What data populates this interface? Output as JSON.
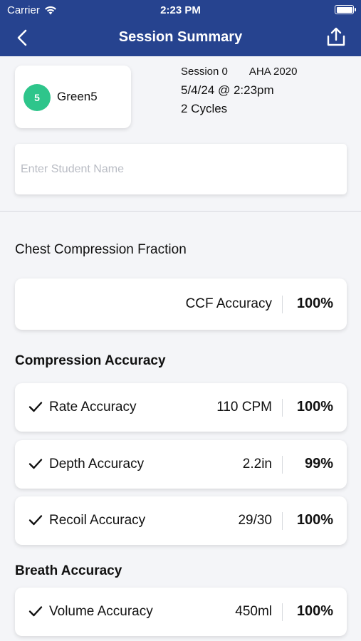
{
  "status_bar": {
    "carrier": "Carrier",
    "time": "2:23 PM"
  },
  "nav": {
    "title": "Session Summary",
    "back_icon": "chevron-left-icon",
    "share_icon": "share-upload-icon"
  },
  "device": {
    "badge": "5",
    "name": "Green5",
    "badge_color": "#2ec58b"
  },
  "session": {
    "label": "Session 0",
    "protocol": "AHA 2020",
    "datetime": "5/4/24 @ 2:23pm",
    "cycles": "2 Cycles"
  },
  "student": {
    "placeholder": "Enter Student Name",
    "value": ""
  },
  "sections": {
    "ccf_title": "Chest Compression Fraction",
    "compression_title": "Compression Accuracy",
    "breath_title": "Breath Accuracy"
  },
  "ccf": {
    "label": "CCF Accuracy",
    "percent": "100%"
  },
  "compression": [
    {
      "label": "Rate Accuracy",
      "value": "110 CPM",
      "percent": "100%"
    },
    {
      "label": "Depth Accuracy",
      "value": "2.2in",
      "percent": "99%"
    },
    {
      "label": "Recoil Accuracy",
      "value": "29/30",
      "percent": "100%"
    }
  ],
  "breath": [
    {
      "label": "Volume Accuracy",
      "value": "450ml",
      "percent": "100%"
    }
  ],
  "colors": {
    "header": "#26438f",
    "background": "#f4f5f8"
  }
}
